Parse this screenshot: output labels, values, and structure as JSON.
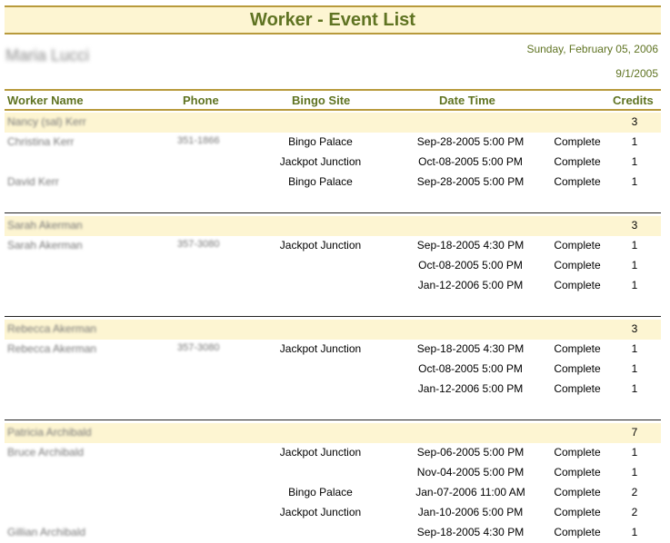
{
  "report": {
    "title": "Worker - Event List",
    "owner": "Maria Lucci",
    "date": "Sunday, February 05, 2006",
    "period": "9/1/2005"
  },
  "columns": {
    "worker_name": "Worker Name",
    "phone": "Phone",
    "bingo_site": "Bingo Site",
    "date_time": "Date Time",
    "credits": "Credits"
  },
  "groups": [
    {
      "name": "Nancy (sal) Kerr",
      "credits": "3",
      "rows": [
        {
          "name": "Christina Kerr",
          "phone": "351-1866",
          "site": "Bingo Palace",
          "datetime": "Sep-28-2005 5:00 PM",
          "status": "Complete",
          "credits": "1"
        },
        {
          "name": "",
          "phone": "",
          "site": "Jackpot Junction",
          "datetime": "Oct-08-2005 5:00 PM",
          "status": "Complete",
          "credits": "1"
        },
        {
          "name": "David Kerr",
          "phone": "",
          "site": "Bingo Palace",
          "datetime": "Sep-28-2005 5:00 PM",
          "status": "Complete",
          "credits": "1"
        }
      ]
    },
    {
      "name": "Sarah Akerman",
      "credits": "3",
      "rows": [
        {
          "name": "Sarah Akerman",
          "phone": "357-3080",
          "site": "Jackpot Junction",
          "datetime": "Sep-18-2005 4:30 PM",
          "status": "Complete",
          "credits": "1"
        },
        {
          "name": "",
          "phone": "",
          "site": "",
          "datetime": "Oct-08-2005 5:00 PM",
          "status": "Complete",
          "credits": "1"
        },
        {
          "name": "",
          "phone": "",
          "site": "",
          "datetime": "Jan-12-2006 5:00 PM",
          "status": "Complete",
          "credits": "1"
        }
      ]
    },
    {
      "name": "Rebecca Akerman",
      "credits": "3",
      "rows": [
        {
          "name": "Rebecca Akerman",
          "phone": "357-3080",
          "site": "Jackpot Junction",
          "datetime": "Sep-18-2005 4:30 PM",
          "status": "Complete",
          "credits": "1"
        },
        {
          "name": "",
          "phone": "",
          "site": "",
          "datetime": "Oct-08-2005 5:00 PM",
          "status": "Complete",
          "credits": "1"
        },
        {
          "name": "",
          "phone": "",
          "site": "",
          "datetime": "Jan-12-2006 5:00 PM",
          "status": "Complete",
          "credits": "1"
        }
      ]
    },
    {
      "name": "Patricia Archibald",
      "credits": "7",
      "rows": [
        {
          "name": "Bruce Archibald",
          "phone": "",
          "site": "Jackpot Junction",
          "datetime": "Sep-06-2005 5:00 PM",
          "status": "Complete",
          "credits": "1"
        },
        {
          "name": "",
          "phone": "",
          "site": "",
          "datetime": "Nov-04-2005 5:00 PM",
          "status": "Complete",
          "credits": "1"
        },
        {
          "name": "",
          "phone": "",
          "site": "Bingo Palace",
          "datetime": "Jan-07-2006 11:00 AM",
          "status": "Complete",
          "credits": "2"
        },
        {
          "name": "",
          "phone": "",
          "site": "Jackpot Junction",
          "datetime": "Jan-10-2006 5:00 PM",
          "status": "Complete",
          "credits": "2"
        },
        {
          "name": "Gillian Archibald",
          "phone": "",
          "site": "",
          "datetime": "Sep-18-2005 4:30 PM",
          "status": "Complete",
          "credits": "1"
        }
      ]
    }
  ]
}
